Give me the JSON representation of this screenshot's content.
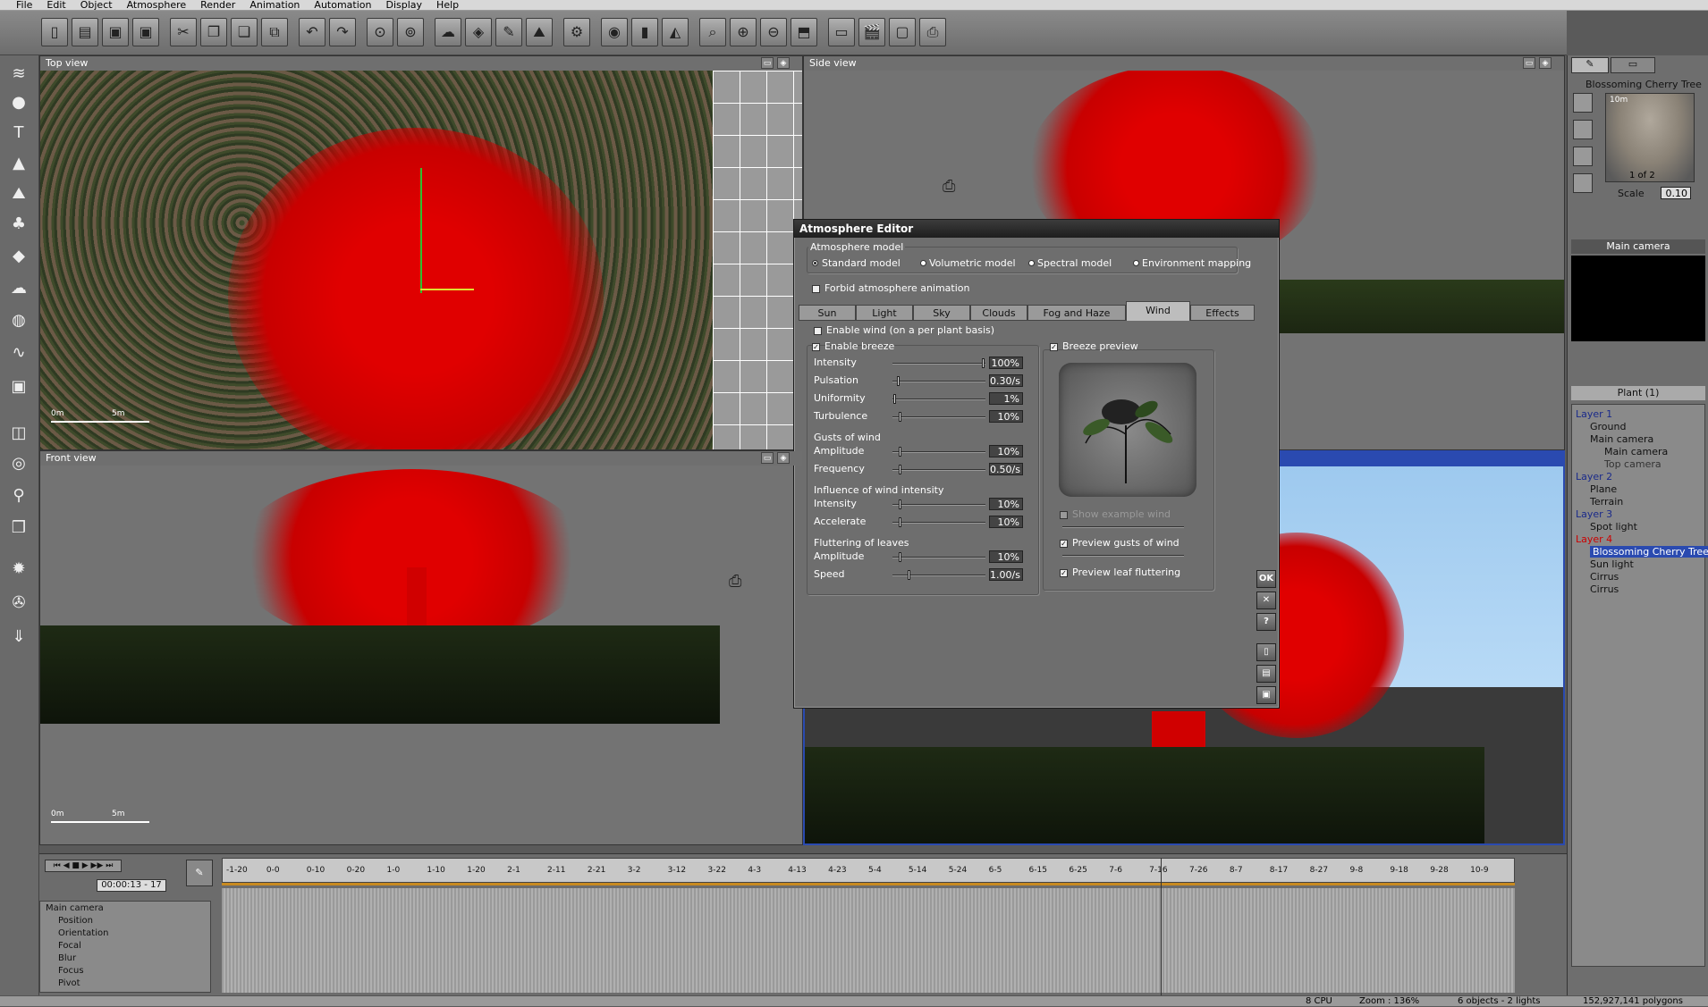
{
  "menu": [
    "File",
    "Edit",
    "Object",
    "Atmosphere",
    "Render",
    "Animation",
    "Automation",
    "Display",
    "Help"
  ],
  "toolbar": {
    "icons": [
      "new-icon",
      "open-icon",
      "save-icon",
      "save-as-icon",
      "cut-icon",
      "copy-icon",
      "paste-icon",
      "duplicate-icon",
      "undo-icon",
      "redo-icon",
      "select-icon",
      "select-all-icon",
      "atmosphere-icon",
      "materials-icon",
      "plant-editor-icon",
      "terrain-editor-icon",
      "spheres-icon",
      "render-icon",
      "align-icon",
      "mirror-icon",
      "zoom-fit-icon",
      "zoom-in-icon",
      "zoom-out-icon",
      "zoom-window-icon",
      "film-icon",
      "clapper-icon",
      "frame-icon",
      "camera-icon"
    ]
  },
  "viewports": {
    "top": {
      "title": "Top view",
      "scale_min": "0m",
      "scale_max": "5m"
    },
    "side": {
      "title": "Side view"
    },
    "front": {
      "title": "Front view",
      "scale_min": "0m",
      "scale_max": "5m"
    }
  },
  "editor": {
    "title": "Atmosphere Editor",
    "model_group": "Atmosphere model",
    "models": [
      "Standard model",
      "Volumetric model",
      "Spectral model",
      "Environment mapping"
    ],
    "forbid_label": "Forbid atmosphere animation",
    "tabs": [
      "Sun",
      "Light",
      "Sky",
      "Clouds",
      "Fog and Haze",
      "Wind",
      "Effects"
    ],
    "active_tab": "Wind",
    "enable_wind_label": "Enable wind (on a per plant basis)",
    "enable_breeze_label": "Enable breeze",
    "breeze": [
      {
        "label": "Intensity",
        "value": "100%",
        "level": 1.0
      },
      {
        "label": "Pulsation",
        "value": "0.30/s",
        "level": 0.05
      },
      {
        "label": "Uniformity",
        "value": "1%",
        "level": 0.01
      },
      {
        "label": "Turbulence",
        "value": "10%",
        "level": 0.07
      }
    ],
    "gusts_group": "Gusts of wind",
    "gusts": [
      {
        "label": "Amplitude",
        "value": "10%",
        "level": 0.07
      },
      {
        "label": "Frequency",
        "value": "0.50/s",
        "level": 0.07
      }
    ],
    "influence_group": "Influence of wind intensity",
    "influence": [
      {
        "label": "Intensity",
        "value": "10%",
        "level": 0.07
      },
      {
        "label": "Accelerate",
        "value": "10%",
        "level": 0.07
      }
    ],
    "flutter_group": "Fluttering of leaves",
    "flutter": [
      {
        "label": "Amplitude",
        "value": "10%",
        "level": 0.07
      },
      {
        "label": "Speed",
        "value": "1.00/s",
        "level": 0.17
      }
    ],
    "breeze_preview_label": "Breeze preview",
    "show_example_label": "Show example wind",
    "preview_gusts_label": "Preview gusts of wind",
    "preview_leaf_label": "Preview leaf fluttering",
    "ok_label": "OK",
    "close_label": "✕",
    "help_label": "?"
  },
  "right_panel": {
    "object_name": "Blossoming Cherry Tree",
    "preview_size": "10m",
    "preview_page": "1 of 2",
    "scale_label": "Scale",
    "scale_value": "0.10",
    "camera_label": "Main camera",
    "plant_count": "Plant (1)",
    "world_tree": [
      {
        "label": "Layer 1",
        "level": 0,
        "color": "#1a2a8a"
      },
      {
        "label": "Ground",
        "level": 1,
        "color": "#111"
      },
      {
        "label": "Main camera",
        "level": 1,
        "color": "#111"
      },
      {
        "label": "Main camera",
        "level": 2,
        "color": "#111"
      },
      {
        "label": "Top camera",
        "level": 2,
        "color": "#333"
      },
      {
        "label": "Layer 2",
        "level": 0,
        "color": "#1a2a8a"
      },
      {
        "label": "Plane",
        "level": 1,
        "color": "#111"
      },
      {
        "label": "Terrain",
        "level": 1,
        "color": "#111"
      },
      {
        "label": "Layer 3",
        "level": 0,
        "color": "#1a2a8a"
      },
      {
        "label": "Spot light",
        "level": 1,
        "color": "#111"
      },
      {
        "label": "Layer 4",
        "level": 0,
        "color": "#cc0000"
      },
      {
        "label": "Blossoming Cherry Tree",
        "level": 1,
        "color": "#ffffff",
        "selected": true
      },
      {
        "label": "Sun light",
        "level": 1,
        "color": "#111"
      },
      {
        "label": "Cirrus",
        "level": 1,
        "color": "#111"
      },
      {
        "label": "Cirrus",
        "level": 1,
        "color": "#111"
      }
    ]
  },
  "timeline": {
    "time": "00:00:13 - 17",
    "ticks": [
      "-1-20",
      "0-0",
      "0-10",
      "0-20",
      "1-0",
      "1-10",
      "1-20",
      "2-1",
      "2-11",
      "2-21",
      "3-2",
      "3-12",
      "3-22",
      "4-3",
      "4-13",
      "4-23",
      "5-4",
      "5-14",
      "5-24",
      "6-5",
      "6-15",
      "6-25",
      "7-6",
      "7-16",
      "7-26",
      "8-7",
      "8-17",
      "8-27",
      "9-8",
      "9-18",
      "9-28",
      "10-9"
    ],
    "tracks": [
      "Main camera",
      "Position",
      "Orientation",
      "Focal",
      "Blur",
      "Focus",
      "Pivot"
    ]
  },
  "status": {
    "cpu": "8 CPU",
    "zoom": "Zoom : 136%",
    "objects": "6 objects - 2 lights",
    "polygons": "152,927,141 polygons"
  }
}
